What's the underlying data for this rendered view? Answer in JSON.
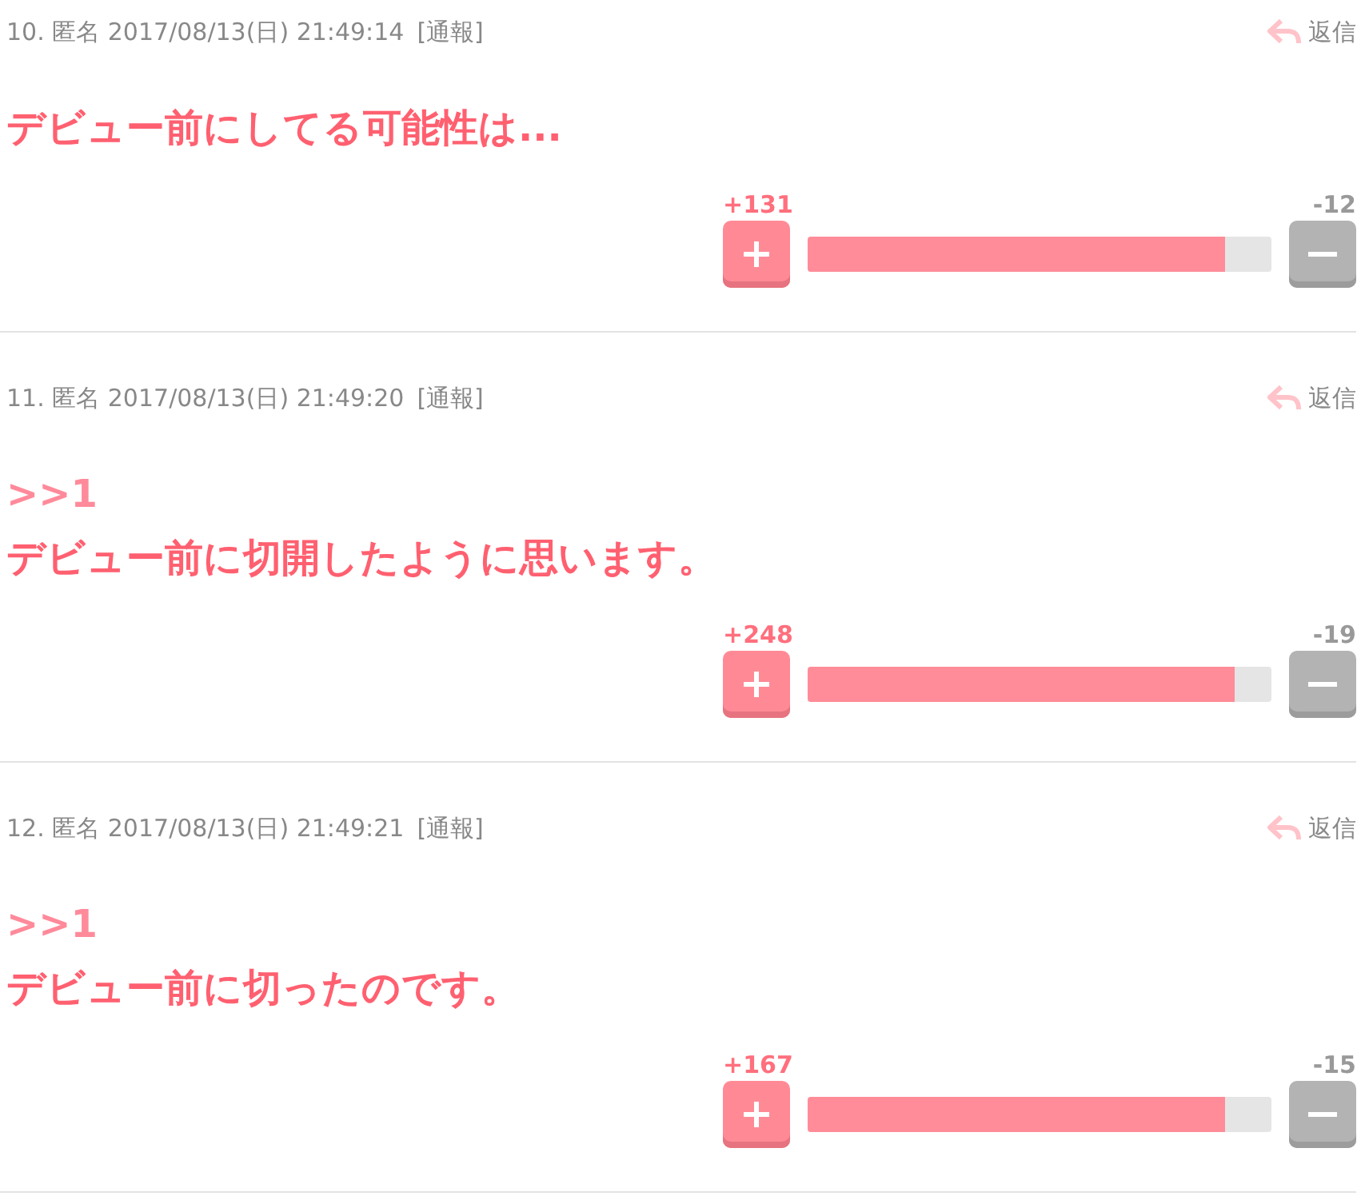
{
  "posts": [
    {
      "meta": "10. 匿名 2017/08/13(日) 21:49:14",
      "report": "[通報]",
      "reply": "返信",
      "lines": [
        {
          "kind": "text",
          "text": "デビュー前にしてる可能性は..."
        }
      ],
      "plus": "+131",
      "minus": "-12",
      "level": 0.9
    },
    {
      "meta": "11. 匿名 2017/08/13(日) 21:49:20",
      "report": "[通報]",
      "reply": "返信",
      "lines": [
        {
          "kind": "anchor",
          "text": ">>1"
        },
        {
          "kind": "text",
          "text": "デビュー前に切開したように思います。"
        }
      ],
      "plus": "+248",
      "minus": "-19",
      "level": 0.92
    },
    {
      "meta": "12. 匿名 2017/08/13(日) 21:49:21",
      "report": "[通報]",
      "reply": "返信",
      "lines": [
        {
          "kind": "anchor",
          "text": ">>1"
        },
        {
          "kind": "text",
          "text": "デビュー前に切ったのです。"
        }
      ],
      "plus": "+167",
      "minus": "-15",
      "level": 0.9
    }
  ]
}
